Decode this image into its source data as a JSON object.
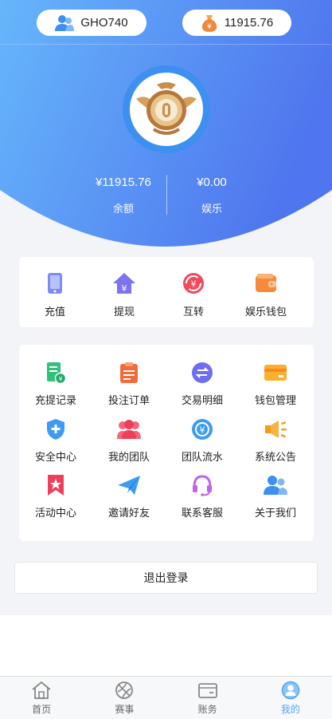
{
  "header": {
    "username": "GHO740",
    "balance_pill": "11915.76",
    "balance_amount": "¥11915.76",
    "balance_label": "余额",
    "entertainment_amount": "¥0.00",
    "entertainment_label": "娱乐"
  },
  "quick_actions": [
    {
      "label": "充值",
      "icon": "phone-icon"
    },
    {
      "label": "提现",
      "icon": "withdraw-house-icon"
    },
    {
      "label": "互转",
      "icon": "transfer-icon"
    },
    {
      "label": "娱乐钱包",
      "icon": "wallet-icon"
    }
  ],
  "menu": [
    {
      "label": "充提记录",
      "icon": "deposit-record-icon"
    },
    {
      "label": "投注订单",
      "icon": "clipboard-icon"
    },
    {
      "label": "交易明细",
      "icon": "exchange-icon"
    },
    {
      "label": "钱包管理",
      "icon": "card-icon"
    },
    {
      "label": "安全中心",
      "icon": "shield-icon"
    },
    {
      "label": "我的团队",
      "icon": "team-icon"
    },
    {
      "label": "团队流水",
      "icon": "team-flow-icon"
    },
    {
      "label": "系统公告",
      "icon": "megaphone-icon"
    },
    {
      "label": "活动中心",
      "icon": "bookmark-star-icon"
    },
    {
      "label": "邀请好友",
      "icon": "paper-plane-icon"
    },
    {
      "label": "联系客服",
      "icon": "headset-icon"
    },
    {
      "label": "关于我们",
      "icon": "people-icon"
    }
  ],
  "logout_label": "退出登录",
  "tabs": [
    {
      "label": "首页",
      "icon": "home-icon"
    },
    {
      "label": "赛事",
      "icon": "ball-icon"
    },
    {
      "label": "账务",
      "icon": "wallet-tab-icon"
    },
    {
      "label": "我的",
      "icon": "profile-icon"
    }
  ],
  "colors": {
    "header_gradient_start": "#63b3fb",
    "header_gradient_end": "#5078ee",
    "active_tab": "#4da6f3"
  }
}
